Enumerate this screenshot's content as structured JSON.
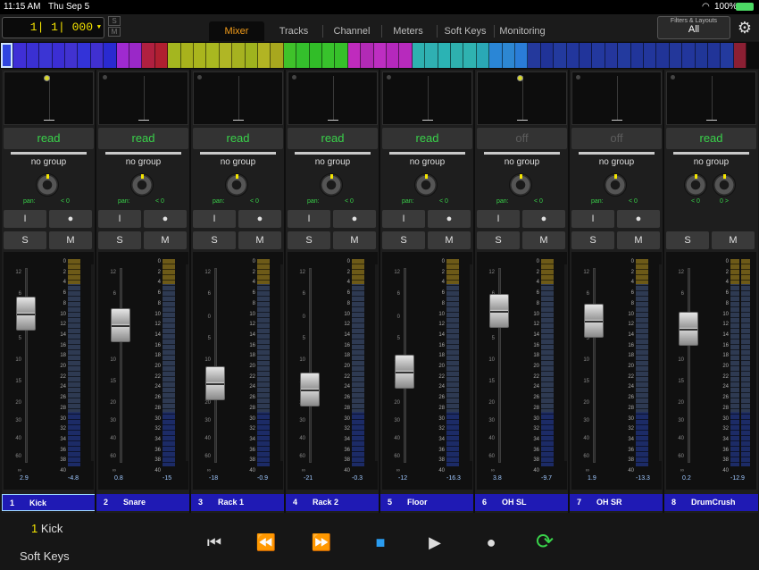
{
  "status": {
    "time": "11:15 AM",
    "date": "Thu Sep 5",
    "battery": "100%"
  },
  "header": {
    "counter": "1| 1| 000",
    "s_label": "S",
    "m_label": "M",
    "tabs": [
      {
        "label": "Mixer",
        "active": true
      },
      {
        "label": "Tracks"
      },
      {
        "label": "Channel"
      },
      {
        "label": "Meters"
      },
      {
        "label": "Soft Keys"
      },
      {
        "label": "Monitoring"
      }
    ],
    "filters_label": "Filters & Layouts",
    "filters_value": "All",
    "settings_icon": "gear-icon"
  },
  "color_strip": {
    "colors": [
      "#2f46e0",
      "#3f2fd6",
      "#3a30d2",
      "#3b35d4",
      "#3b2ed4",
      "#4132d0",
      "#3333d8",
      "#4030d0",
      "#2a2ad0",
      "#9f2ad0",
      "#9a28c8",
      "#b02040",
      "#b01f30",
      "#a4b61f",
      "#a8b21c",
      "#aab51d",
      "#a9b820",
      "#b0b625",
      "#a6b220",
      "#9fb31e",
      "#b2b423",
      "#a8a71e",
      "#3fc22a",
      "#34c02c",
      "#31bd28",
      "#38c22c",
      "#36c02a",
      "#bf2bbd",
      "#b22ab6",
      "#bd2ec2",
      "#b528bc",
      "#b72abd",
      "#2eb1b0",
      "#2fb0b2",
      "#2bb3b4",
      "#2eb0ae",
      "#2fb2b0",
      "#2aa8b6",
      "#2a86d6",
      "#2d87d2",
      "#2a7dd8",
      "#24399c",
      "#203398",
      "#233a9e",
      "#22369c",
      "#21349a",
      "#23389e",
      "#24369c",
      "#233a9e",
      "#21359a",
      "#22369c",
      "#213498",
      "#23379a",
      "#22369c",
      "#203698",
      "#213498",
      "#233a9e",
      "#8b1f33"
    ]
  },
  "channels": [
    {
      "num": "1",
      "name": "Kick",
      "automation": "read",
      "group": "no group",
      "pan": "< 0",
      "pan_type": "mono",
      "rec": "I",
      "arm": "●",
      "solo": "S",
      "mute": "M",
      "fader_db": "2.9",
      "meter_db": "-4.8",
      "fader_pos": 0.18,
      "selected": true,
      "xy_dot": true
    },
    {
      "num": "2",
      "name": "Snare",
      "automation": "read",
      "group": "no group",
      "pan": "< 0",
      "pan_type": "mono",
      "rec": "I",
      "arm": "●",
      "solo": "S",
      "mute": "M",
      "fader_db": "0.8",
      "meter_db": "-15",
      "fader_pos": 0.25,
      "selected": false,
      "xy_dot": false
    },
    {
      "num": "3",
      "name": "Rack 1",
      "automation": "read",
      "group": "no group",
      "pan": "< 0",
      "pan_type": "mono",
      "rec": "I",
      "arm": "●",
      "solo": "S",
      "mute": "M",
      "fader_db": "-18",
      "meter_db": "-0.9",
      "fader_pos": 0.61,
      "selected": false,
      "xy_dot": false
    },
    {
      "num": "4",
      "name": "Rack 2",
      "automation": "read",
      "group": "no group",
      "pan": "< 0",
      "pan_type": "mono",
      "rec": "I",
      "arm": "●",
      "solo": "S",
      "mute": "M",
      "fader_db": "-21",
      "meter_db": "-0.3",
      "fader_pos": 0.65,
      "selected": false,
      "xy_dot": false
    },
    {
      "num": "5",
      "name": "Floor",
      "automation": "read",
      "group": "no group",
      "pan": "< 0",
      "pan_type": "mono",
      "rec": "I",
      "arm": "●",
      "solo": "S",
      "mute": "M",
      "fader_db": "-12",
      "meter_db": "-16.3",
      "fader_pos": 0.54,
      "selected": false,
      "xy_dot": false
    },
    {
      "num": "6",
      "name": "OH SL",
      "automation": "off",
      "group": "no group",
      "pan": "< 0",
      "pan_type": "mono",
      "rec": "I",
      "arm": "●",
      "solo": "S",
      "mute": "M",
      "fader_db": "3.8",
      "meter_db": "-9.7",
      "fader_pos": 0.16,
      "selected": false,
      "xy_dot": true
    },
    {
      "num": "7",
      "name": "OH SR",
      "automation": "off",
      "group": "no group",
      "pan": "< 0",
      "pan_type": "mono",
      "rec": "I",
      "arm": "●",
      "solo": "S",
      "mute": "M",
      "fader_db": "1.9",
      "meter_db": "-13.3",
      "fader_pos": 0.22,
      "selected": false,
      "xy_dot": false
    },
    {
      "num": "8",
      "name": "DrumCrush",
      "automation": "read",
      "group": "no group",
      "pan": "< 0",
      "pan_r": "0 >",
      "pan_type": "stereo",
      "solo": "S",
      "mute": "M",
      "fader_db": "0.2",
      "meter_db": "-12.9",
      "fader_pos": 0.27,
      "selected": false,
      "xy_dot": false
    }
  ],
  "pan_label": "pan:",
  "fader_scale": [
    "12",
    "6",
    "0",
    "5",
    "10",
    "15",
    "20",
    "30",
    "40",
    "60",
    "∞"
  ],
  "meter_scale": [
    "0",
    "2",
    "4",
    "6",
    "8",
    "10",
    "12",
    "14",
    "16",
    "18",
    "20",
    "22",
    "24",
    "26",
    "28",
    "30",
    "32",
    "34",
    "36",
    "38",
    "40"
  ],
  "footer": {
    "track_num": "1",
    "track_name": "Kick",
    "soft_keys": "Soft Keys",
    "transport": [
      {
        "icon": "rewind-to-start-icon",
        "glyph": "⏮",
        "color": "#dddddd"
      },
      {
        "icon": "rewind-icon",
        "glyph": "⏪",
        "color": "#dddddd"
      },
      {
        "icon": "fast-forward-icon",
        "glyph": "⏩",
        "color": "#dddddd"
      },
      {
        "icon": "stop-icon",
        "glyph": "■",
        "color": "#2a9cf0"
      },
      {
        "icon": "play-icon",
        "glyph": "▶",
        "color": "#dddddd"
      },
      {
        "icon": "record-icon",
        "glyph": "●",
        "color": "#dddddd"
      },
      {
        "icon": "loop-play-icon",
        "glyph": "⟳",
        "color": "#39d24a"
      }
    ]
  }
}
